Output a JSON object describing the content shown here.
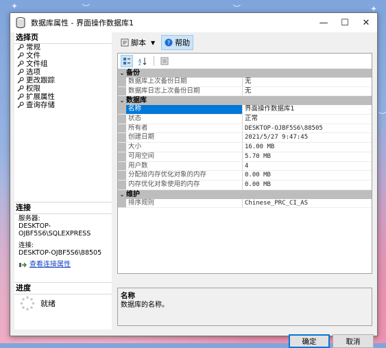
{
  "window": {
    "title": "数据库属性 - 界面操作数据库1",
    "minimize_label": "—",
    "maximize_label": "☐",
    "close_label": "✕"
  },
  "left": {
    "select_page_label": "选择页",
    "pages": [
      "常规",
      "文件",
      "文件组",
      "选项",
      "更改跟踪",
      "权限",
      "扩展属性",
      "查询存储"
    ],
    "connection_label": "连接",
    "server_label": "服务器:",
    "server_value": "DESKTOP-OJBF5S6\\SQLEXPRESS",
    "conn_label": "连接:",
    "conn_value": "DESKTOP-OJBF5S6\\88505",
    "view_conn_props": "查看连接属性",
    "progress_label": "进度",
    "progress_status": "就绪"
  },
  "toolbar": {
    "script_label": "脚本",
    "help_label": "帮助"
  },
  "grid": {
    "backup": {
      "category": "备份",
      "rows": [
        {
          "name": "数据库上次备份日期",
          "value": "无"
        },
        {
          "name": "数据库日志上次备份日期",
          "value": "无"
        }
      ]
    },
    "database": {
      "category": "数据库",
      "rows": [
        {
          "name": "名称",
          "value": "界面操作数据库1"
        },
        {
          "name": "状态",
          "value": "正常"
        },
        {
          "name": "所有者",
          "value": "DESKTOP-OJBF5S6\\88505"
        },
        {
          "name": "创建日期",
          "value": "2021/5/27 9:47:45"
        },
        {
          "name": "大小",
          "value": "16.00 MB"
        },
        {
          "name": "可用空间",
          "value": "5.70 MB"
        },
        {
          "name": "用户数",
          "value": "4"
        },
        {
          "name": "分配给内存优化对象的内存",
          "value": "0.00 MB"
        },
        {
          "name": "内存优化对象使用的内存",
          "value": "0.00 MB"
        }
      ]
    },
    "maintenance": {
      "category": "维护",
      "rows": [
        {
          "name": "排序规则",
          "value": "Chinese_PRC_CI_AS"
        }
      ]
    }
  },
  "description": {
    "title": "名称",
    "text": "数据库的名称。"
  },
  "buttons": {
    "ok_label": "确定",
    "cancel_label": "取消"
  },
  "colors": {
    "accent": "#0078d7",
    "link": "#1a44c2",
    "category_bg": "#bdbdbd"
  }
}
